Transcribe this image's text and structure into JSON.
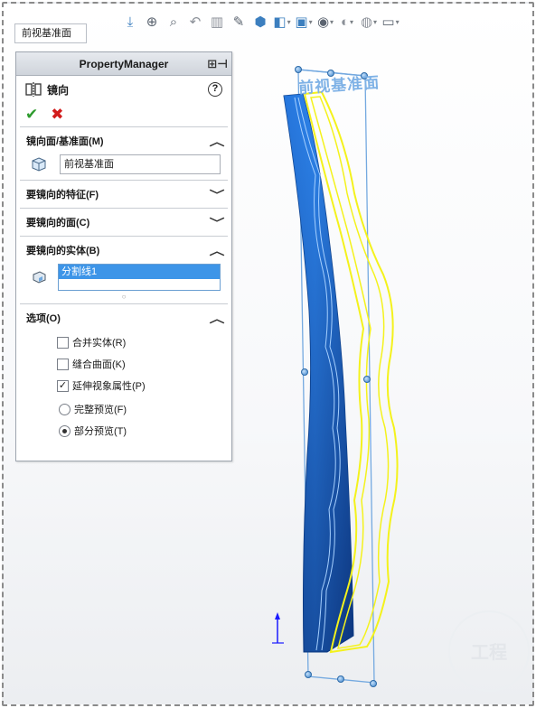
{
  "breadcrumb": "前视基准面",
  "toolbar": {
    "icons": [
      "view-orientation-icon",
      "zoom-to-fit-icon",
      "zoom-area-icon",
      "previous-view-icon",
      "section-view-icon",
      "dynamic-annotation-icon",
      "view-cube-icon",
      "display-style-icon",
      "hide-show-icon",
      "edit-appearance-icon",
      "apply-scene-icon",
      "view-settings-icon"
    ]
  },
  "property_manager": {
    "header": "PropertyManager",
    "feature_title": "镜向",
    "sections": {
      "mirror_plane": {
        "label": "镜向面/基准面(M)",
        "value": "前视基准面"
      },
      "features": {
        "label": "要镜向的特征(F)"
      },
      "faces": {
        "label": "要镜向的面(C)"
      },
      "bodies": {
        "label": "要镜向的实体(B)",
        "selected": "分割线1"
      },
      "options": {
        "label": "选项(O)",
        "merge_solids": "合并实体(R)",
        "knit_surfaces": "缝合曲面(K)",
        "propagate_visual": "延伸视象属性(P)",
        "full_preview": "完整预览(F)",
        "partial_preview": "部分预览(T)"
      }
    },
    "states": {
      "merge_solids": false,
      "knit_surfaces": false,
      "propagate_visual": true,
      "preview_mode": "partial"
    }
  },
  "viewport": {
    "plane_label": "前视基准面",
    "colors": {
      "body": "#1f6fd6",
      "mirror_preview": "#ffff22",
      "plane": "#7fb2e6",
      "triad": "#1a1aff"
    }
  },
  "watermark": "工程"
}
